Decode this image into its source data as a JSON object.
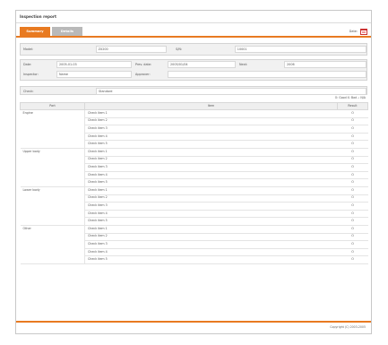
{
  "window": {
    "title": "Inspection report"
  },
  "tabs": [
    {
      "label": "Summary"
    },
    {
      "label": "Details"
    }
  ],
  "header_right": {
    "label": "Date:"
  },
  "info": {
    "model_label": "Model:",
    "model_value": "ZX200",
    "serial_label": "S/N:",
    "serial_value": "10001",
    "date_label": "Date:",
    "date_value": "2005-01-03",
    "prev_date_label": "Prev. date:",
    "prev_date_value": "2005/01/04",
    "next_label": "Next:",
    "next_value": "2006",
    "inspector_label": "Inspector:",
    "inspector_value": "Name",
    "approver_label": "Approver:",
    "approver_value": "",
    "check_label": "Check:",
    "check_value": "Standard"
  },
  "legend": "O: Good   X: Bad   -: N/A",
  "table": {
    "headers": [
      "Part",
      "Item",
      "Result"
    ],
    "groups": [
      {
        "name": "Engine",
        "rows": [
          {
            "item": "Check item 1",
            "result": "O"
          },
          {
            "item": "Check item 2",
            "result": "O"
          },
          {
            "item": "Check item 3",
            "result": "O"
          },
          {
            "item": "Check item 4",
            "result": "O"
          },
          {
            "item": "Check item 5",
            "result": "O"
          }
        ]
      },
      {
        "name": "Upper body",
        "rows": [
          {
            "item": "Check item 1",
            "result": "O"
          },
          {
            "item": "Check item 2",
            "result": "O"
          },
          {
            "item": "Check item 3",
            "result": "O"
          },
          {
            "item": "Check item 4",
            "result": "O"
          },
          {
            "item": "Check item 5",
            "result": "O"
          }
        ]
      },
      {
        "name": "Lower body",
        "rows": [
          {
            "item": "Check item 1",
            "result": "O"
          },
          {
            "item": "Check item 2",
            "result": "O"
          },
          {
            "item": "Check item 3",
            "result": "O"
          },
          {
            "item": "Check item 4",
            "result": "O"
          },
          {
            "item": "Check item 5",
            "result": "O"
          }
        ]
      },
      {
        "name": "Other",
        "rows": [
          {
            "item": "Check item 1",
            "result": "O"
          },
          {
            "item": "Check item 2",
            "result": "O"
          },
          {
            "item": "Check item 3",
            "result": "O"
          },
          {
            "item": "Check item 4",
            "result": "O"
          },
          {
            "item": "Check item 5",
            "result": "O"
          }
        ]
      }
    ]
  },
  "footer": {
    "copyright": "Copyright (C) 2003-2005"
  },
  "colors": {
    "accent": "#e87a21",
    "tab_inactive": "#b9b9b9",
    "panel_bg": "#f1f1f1"
  }
}
